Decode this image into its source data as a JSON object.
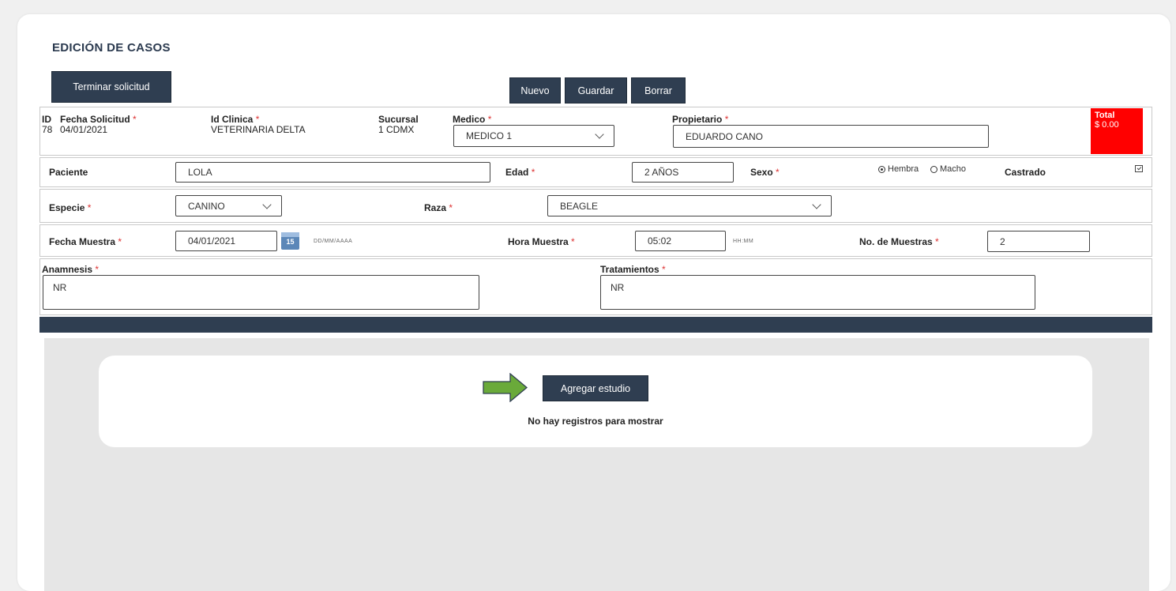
{
  "page": {
    "title": "EDICIÓN DE CASOS"
  },
  "toolbar": {
    "terminar": "Terminar solicitud",
    "nuevo": "Nuevo",
    "guardar": "Guardar",
    "borrar": "Borrar"
  },
  "header_row": {
    "id_label": "ID",
    "id_value": "78",
    "fecha_label": "Fecha Solicitud",
    "fecha_value": "04/01/2021",
    "clinica_label": "Id Clinica",
    "clinica_value": "VETERINARIA DELTA",
    "sucursal_label": "Sucursal",
    "sucursal_value": "1 CDMX",
    "medico_label": "Medico",
    "medico_value": "MEDICO 1",
    "propietario_label": "Propietario",
    "propietario_value": "EDUARDO CANO",
    "total_label": "Total",
    "total_value": "$ 0.00",
    "required_mark": "*"
  },
  "paciente_row": {
    "paciente_label": "Paciente",
    "paciente_value": "LOLA",
    "edad_label": "Edad",
    "edad_value": "2 AÑOS",
    "sexo_label": "Sexo",
    "sexo_options": [
      "Hembra",
      "Macho"
    ],
    "sexo_selected": "Hembra",
    "castrado_label": "Castrado"
  },
  "especie_row": {
    "especie_label": "Especie",
    "especie_value": "CANINO",
    "raza_label": "Raza",
    "raza_value": "BEAGLE"
  },
  "muestra_row": {
    "fecha_label": "Fecha Muestra",
    "fecha_value": "04/01/2021",
    "fecha_hint": "DD/MM/AAAA",
    "calendar_day": "15",
    "hora_label": "Hora Muestra",
    "hora_value": "05:02",
    "hora_hint": "HH:MM",
    "num_label": "No. de Muestras",
    "num_value": "2"
  },
  "notes_row": {
    "anamnesis_label": "Anamnesis",
    "anamnesis_value": "NR",
    "tratamientos_label": "Tratamientos",
    "tratamientos_value": "NR"
  },
  "studies": {
    "add_button": "Agregar estudio",
    "empty_text": "No hay registros para mostrar"
  },
  "colors": {
    "primary": "#2f3e51",
    "total_bg": "#ff0000",
    "arrow": "#6aaa3a",
    "required": "#dd3333"
  }
}
